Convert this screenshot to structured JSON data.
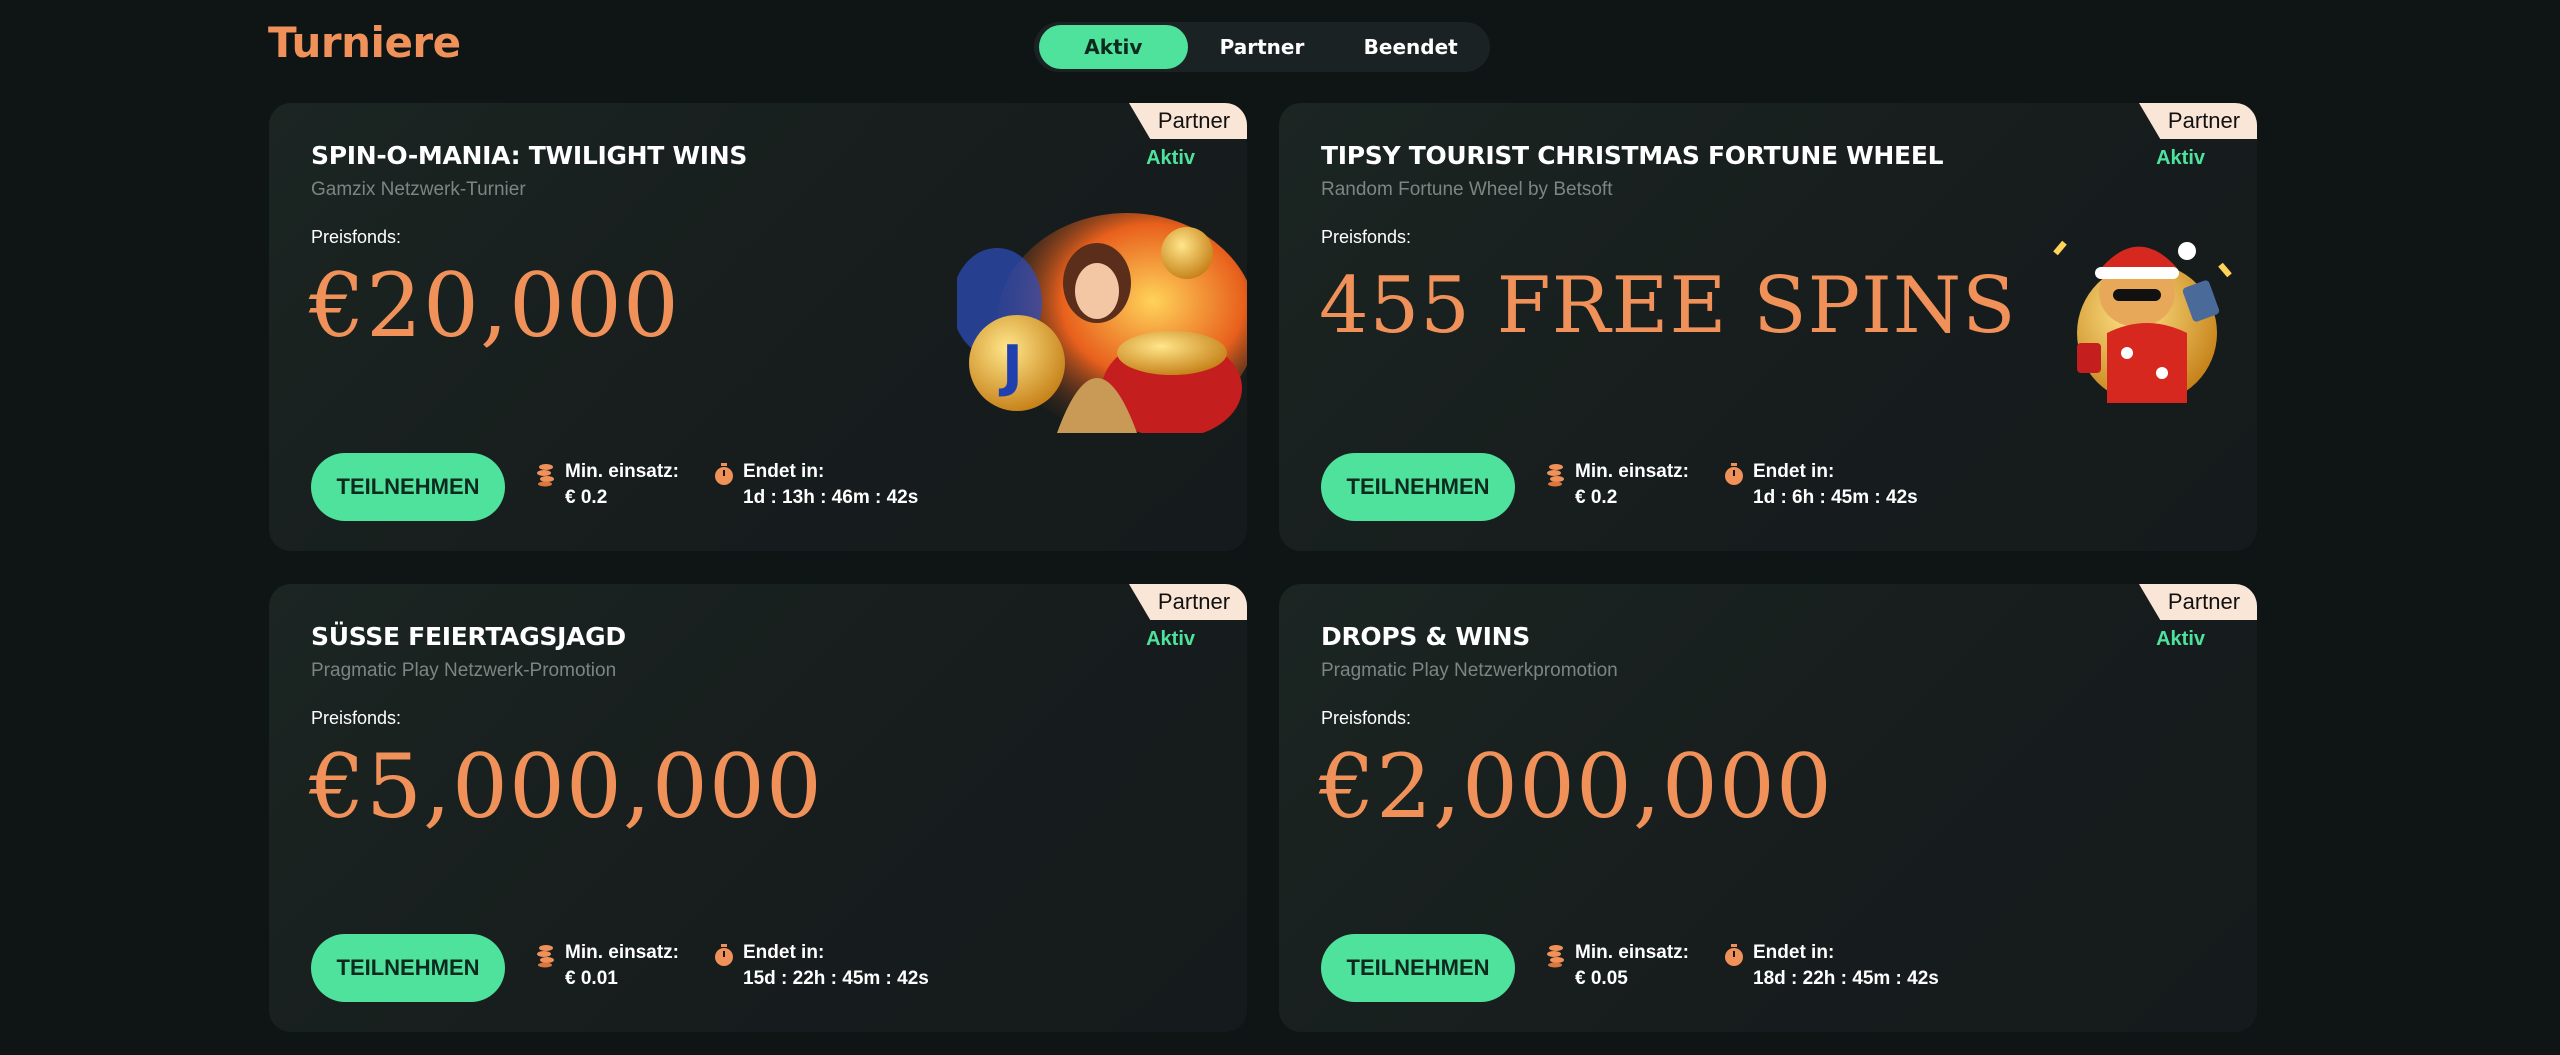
{
  "page": {
    "title": "Turniere"
  },
  "tabs": [
    {
      "label": "Aktiv",
      "active": true
    },
    {
      "label": "Partner",
      "active": false
    },
    {
      "label": "Beendet",
      "active": false
    }
  ],
  "cards": [
    {
      "badge": "Partner",
      "title": "SPIN-O-MANIA: TWILIGHT WINS",
      "subtitle": "Gamzix Netzwerk-Turnier",
      "status": "Aktiv",
      "prize_label": "Preisfonds:",
      "prize": "€20,000",
      "button": "TEILNEHMEN",
      "stake_label": "Min. einsatz:",
      "stake": "€ 0.2",
      "end_label": "Endet in:",
      "end": "1d : 13h : 46m : 42s"
    },
    {
      "badge": "Partner",
      "title": "TIPSY TOURIST CHRISTMAS FORTUNE WHEEL",
      "subtitle": "Random Fortune Wheel by Betsoft",
      "status": "Aktiv",
      "prize_label": "Preisfonds:",
      "prize": "455 FREE SPINS",
      "button": "TEILNEHMEN",
      "stake_label": "Min. einsatz:",
      "stake": "€ 0.2",
      "end_label": "Endet in:",
      "end": "1d : 6h : 45m : 42s"
    },
    {
      "badge": "Partner",
      "title": "SÜSSE FEIERTAGSJAGD",
      "subtitle": "Pragmatic Play Netzwerk-Promotion",
      "status": "Aktiv",
      "prize_label": "Preisfonds:",
      "prize": "€5,000,000",
      "button": "TEILNEHMEN",
      "stake_label": "Min. einsatz:",
      "stake": "€ 0.01",
      "end_label": "Endet in:",
      "end": "15d : 22h : 45m : 42s"
    },
    {
      "badge": "Partner",
      "title": "DROPS & WINS",
      "subtitle": "Pragmatic Play Netzwerkpromotion",
      "status": "Aktiv",
      "prize_label": "Preisfonds:",
      "prize": "€2,000,000",
      "button": "TEILNEHMEN",
      "stake_label": "Min. einsatz:",
      "stake": "€ 0.05",
      "end_label": "Endet in:",
      "end": "18d : 22h : 45m : 42s"
    }
  ],
  "colors": {
    "accent_green": "#4ee29c",
    "accent_orange": "#f0915a",
    "badge_bg": "#fae6d6",
    "background": "#0f1415"
  },
  "icons": {
    "stake": "coins-icon",
    "end": "stopwatch-icon"
  }
}
